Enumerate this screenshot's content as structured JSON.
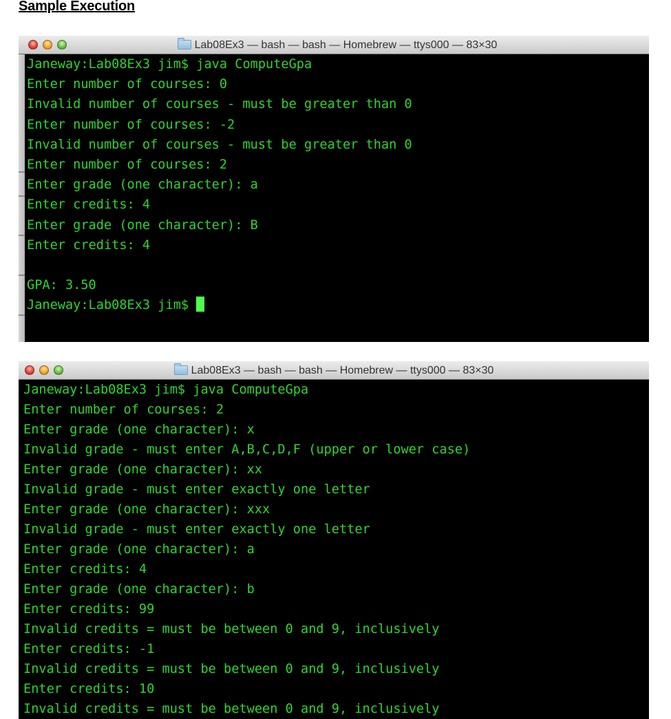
{
  "document": {
    "heading": "Sample Execution"
  },
  "colors": {
    "terminal_background": "#000000",
    "terminal_text": "#2fd52f",
    "cursor": "#4dff4d",
    "close_button": "#e2463a",
    "minimize_button": "#f0a530",
    "zoom_button": "#6cc04a"
  },
  "windows": [
    {
      "title": "Lab08Ex3 — bash — bash — Homebrew — ttys000 — 83×30",
      "title_icon": "folder-icon",
      "lines": [
        "Janeway:Lab08Ex3 jim$ java ComputeGpa",
        "Enter number of courses: 0",
        "Invalid number of courses - must be greater than 0",
        "Enter number of courses: -2",
        "Invalid number of courses - must be greater than 0",
        "Enter number of courses: 2",
        "Enter grade (one character): a",
        "Enter credits: 4",
        "Enter grade (one character): B",
        "Enter credits: 4",
        "",
        "GPA: 3.50"
      ],
      "prompt": "Janeway:Lab08Ex3 jim$ ",
      "has_cursor": true
    },
    {
      "title": "Lab08Ex3 — bash — bash — Homebrew — ttys000 — 83×30",
      "title_icon": "folder-icon",
      "lines": [
        "Janeway:Lab08Ex3 jim$ java ComputeGpa",
        "Enter number of courses: 2",
        "Enter grade (one character): x",
        "Invalid grade - must enter A,B,C,D,F (upper or lower case)",
        "Enter grade (one character): xx",
        "Invalid grade - must enter exactly one letter",
        "Enter grade (one character): xxx",
        "Invalid grade - must enter exactly one letter",
        "Enter grade (one character): a",
        "Enter credits: 4",
        "Enter grade (one character): b",
        "Enter credits: 99",
        "Invalid credits = must be between 0 and 9, inclusively",
        "Enter credits: -1",
        "Invalid credits = must be between 0 and 9, inclusively",
        "Enter credits: 10",
        "Invalid credits = must be between 0 and 9, inclusively"
      ]
    }
  ]
}
